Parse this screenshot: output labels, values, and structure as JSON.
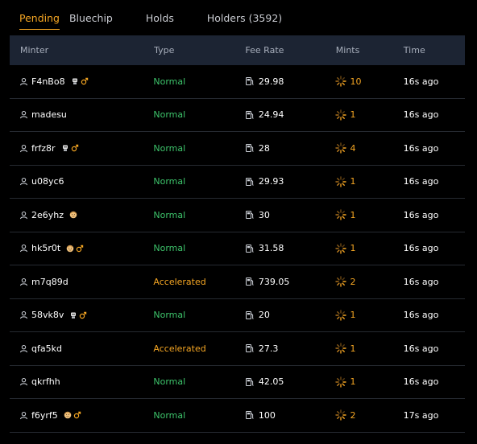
{
  "tabs": [
    {
      "label": "Pending",
      "active": true
    },
    {
      "label": "Bluechip",
      "active": false
    },
    {
      "label": "Holds",
      "active": false
    },
    {
      "label": "Holders (3592)",
      "active": false
    }
  ],
  "columns": {
    "minter": "Minter",
    "type": "Type",
    "fee_rate": "Fee Rate",
    "mints": "Mints",
    "time": "Time"
  },
  "colors": {
    "accent": "#f5a623",
    "normal": "#3dc46b",
    "header_bg": "#1c2433"
  },
  "rows": [
    {
      "minter": "F4nBo8",
      "badges": [
        "robot-icon",
        "male-icon"
      ],
      "type": "Normal",
      "fee_rate": "29.98",
      "mints": "10",
      "time": "16s ago"
    },
    {
      "minter": "madesu",
      "badges": [],
      "type": "Normal",
      "fee_rate": "24.94",
      "mints": "1",
      "time": "16s ago"
    },
    {
      "minter": "frfz8r",
      "badges": [
        "robot-icon",
        "male-icon"
      ],
      "type": "Normal",
      "fee_rate": "28",
      "mints": "4",
      "time": "16s ago"
    },
    {
      "minter": "u08yc6",
      "badges": [],
      "type": "Normal",
      "fee_rate": "29.93",
      "mints": "1",
      "time": "16s ago"
    },
    {
      "minter": "2e6yhz",
      "badges": [
        "face-icon"
      ],
      "type": "Normal",
      "fee_rate": "30",
      "mints": "1",
      "time": "16s ago"
    },
    {
      "minter": "hk5r0t",
      "badges": [
        "face-icon",
        "male-icon"
      ],
      "type": "Normal",
      "fee_rate": "31.58",
      "mints": "1",
      "time": "16s ago"
    },
    {
      "minter": "m7q89d",
      "badges": [],
      "type": "Accelerated",
      "fee_rate": "739.05",
      "mints": "2",
      "time": "16s ago"
    },
    {
      "minter": "58vk8v",
      "badges": [
        "robot-icon",
        "male-icon"
      ],
      "type": "Normal",
      "fee_rate": "20",
      "mints": "1",
      "time": "16s ago"
    },
    {
      "minter": "qfa5kd",
      "badges": [],
      "type": "Accelerated",
      "fee_rate": "27.3",
      "mints": "1",
      "time": "16s ago"
    },
    {
      "minter": "qkrfhh",
      "badges": [],
      "type": "Normal",
      "fee_rate": "42.05",
      "mints": "1",
      "time": "16s ago"
    },
    {
      "minter": "f6yrf5",
      "badges": [
        "face-icon",
        "male-icon"
      ],
      "type": "Normal",
      "fee_rate": "100",
      "mints": "2",
      "time": "17s ago"
    }
  ]
}
